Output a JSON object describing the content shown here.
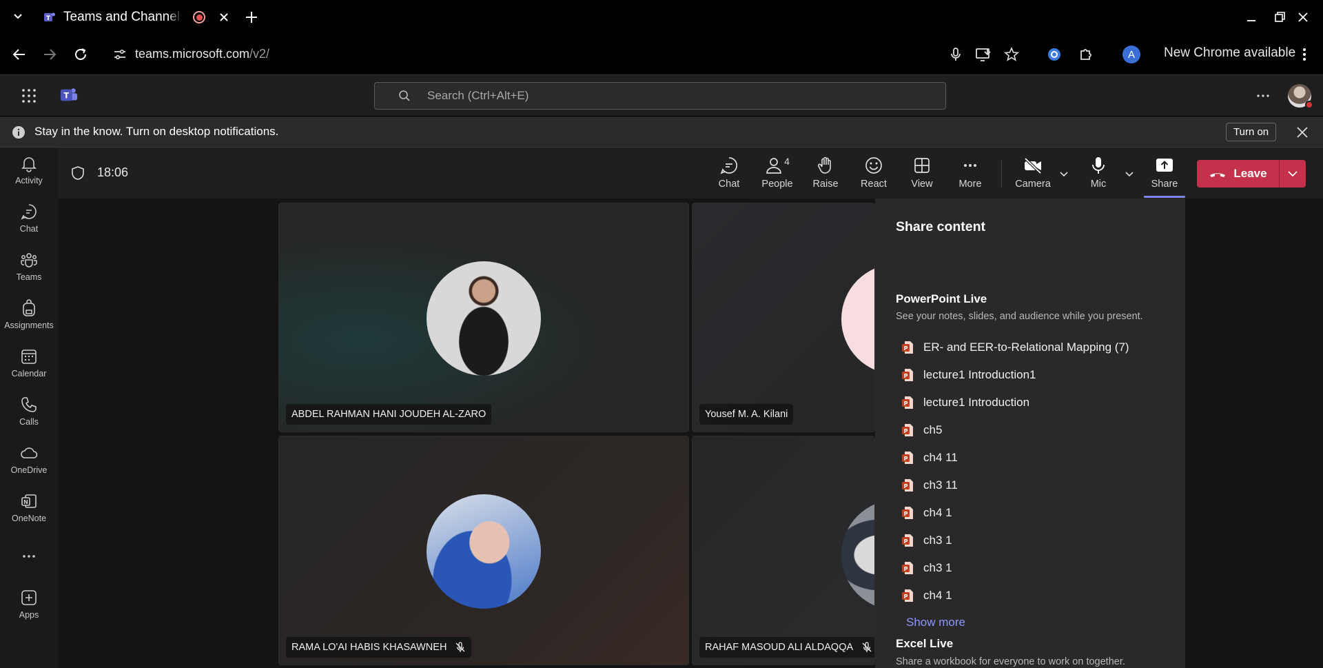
{
  "browser": {
    "tab_title": "Teams and Channels",
    "url_host": "teams.microsoft.com",
    "url_path": "/v2/",
    "profile_initial": "A",
    "new_chrome": "New Chrome available"
  },
  "teams": {
    "search_placeholder": "Search (Ctrl+Alt+E)"
  },
  "notification": {
    "message": "Stay in the know. Turn on desktop notifications.",
    "turn_on": "Turn on"
  },
  "rail": {
    "items": [
      {
        "label": "Activity",
        "icon": "bell-icon"
      },
      {
        "label": "Chat",
        "icon": "chat-icon"
      },
      {
        "label": "Teams",
        "icon": "teams-icon"
      },
      {
        "label": "Assignments",
        "icon": "backpack-icon"
      },
      {
        "label": "Calendar",
        "icon": "calendar-icon"
      },
      {
        "label": "Calls",
        "icon": "phone-icon"
      },
      {
        "label": "OneDrive",
        "icon": "cloud-icon"
      },
      {
        "label": "OneNote",
        "icon": "onenote-icon"
      },
      {
        "label": "Apps",
        "icon": "add-app-icon"
      }
    ]
  },
  "meeting": {
    "timer": "18:06",
    "controls": {
      "chat": "Chat",
      "people": "People",
      "people_count": "4",
      "raise": "Raise",
      "react": "React",
      "view": "View",
      "more": "More",
      "camera": "Camera",
      "mic": "Mic",
      "share": "Share",
      "leave": "Leave"
    },
    "participants": [
      {
        "name": "ABDEL RAHMAN HANI JOUDEH AL-ZARO",
        "muted": false
      },
      {
        "name": "Yousef M. A. Kilani",
        "muted": false
      },
      {
        "name": "RAMA LO'AI HABIS KHASAWNEH",
        "muted": true
      },
      {
        "name": "RAHAF MASOUD ALI ALDAQQA",
        "muted": true
      }
    ]
  },
  "share_panel": {
    "title": "Share content",
    "powerpoint_title": "PowerPoint Live",
    "powerpoint_desc": "See your notes, slides, and audience while you present.",
    "files": [
      "ER- and EER-to-Relational Mapping (7)",
      "lecture1 Introduction1",
      "lecture1 Introduction",
      "ch5",
      "ch4 11",
      "ch3 11",
      "ch4 1",
      "ch3 1",
      "ch3 1",
      "ch4 1"
    ],
    "show_more": "Show more",
    "excel_title": "Excel Live",
    "excel_desc": "Share a workbook for everyone to work on together."
  },
  "colors": {
    "accent": "#7f85f5",
    "leave": "#c4314b",
    "ppt": "#c43e1c"
  }
}
